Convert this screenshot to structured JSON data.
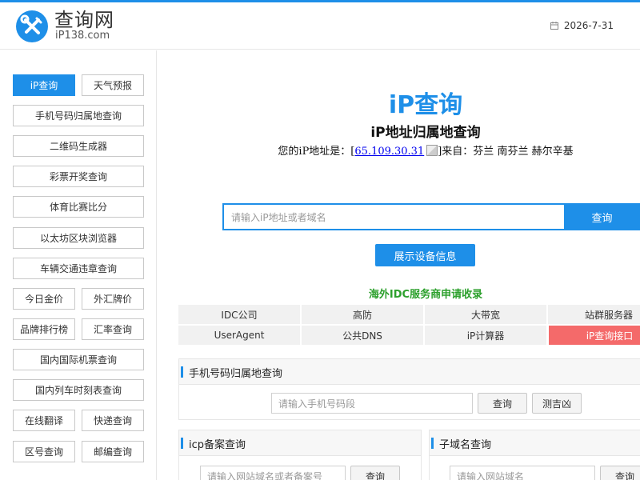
{
  "header": {
    "logo_name": "查询网",
    "logo_sub": "iP138.com",
    "date": "2026-7-31"
  },
  "sidebar": {
    "items": [
      {
        "label": "iP查询",
        "active": true
      },
      {
        "label": "天气预报"
      },
      {
        "label": "手机号码归属地查询"
      },
      {
        "label": "二维码生成器"
      },
      {
        "label": "彩票开奖查询"
      },
      {
        "label": "体育比赛比分"
      },
      {
        "label": "以太坊区块浏览器"
      },
      {
        "label": "车辆交通违章查询"
      },
      {
        "label": "今日金价"
      },
      {
        "label": "外汇牌价"
      },
      {
        "label": "品牌排行榜"
      },
      {
        "label": "汇率查询"
      },
      {
        "label": "国内国际机票查询"
      },
      {
        "label": "国内列车时刻表查询"
      },
      {
        "label": "在线翻译"
      },
      {
        "label": "快递查询"
      },
      {
        "label": "区号查询"
      },
      {
        "label": "邮编查询"
      }
    ]
  },
  "main": {
    "brand": "iP查询",
    "subtitle": "iP地址归属地查询",
    "ip_prefix": "您的iP地址是：[",
    "ip_value": "65.109.30.31",
    "ip_suffix": "]来自：芬兰 南芬兰 赫尔辛基",
    "search_placeholder": "请输入iP地址或者域名",
    "search_button": "查询",
    "device_button": "展示设备信息",
    "idc_title": "海外IDC服务商申请收录",
    "idc_links": [
      {
        "label": "IDC公司"
      },
      {
        "label": "高防"
      },
      {
        "label": "大带宽"
      },
      {
        "label": "站群服务器"
      },
      {
        "label": "UserAgent"
      },
      {
        "label": "公共DNS"
      },
      {
        "label": "iP计算器"
      },
      {
        "label": "iP查询接口"
      }
    ]
  },
  "panels": {
    "phone": {
      "title": "手机号码归属地查询",
      "placeholder": "请输入手机号码段",
      "query_button": "查询",
      "luck_button": "测吉凶"
    },
    "icp": {
      "title": "icp备案查询",
      "placeholder": "请输入网站域名或者备案号",
      "query_button": "查询"
    },
    "subdomain": {
      "title": "子域名查询",
      "placeholder": "请输入网站域名",
      "query_button": "查询"
    }
  },
  "colors": {
    "accent": "#1e8fe8",
    "idc_green": "#2ca02c",
    "api_red": "#f46a6a"
  },
  "icons": {
    "logo": "wrench-screwdriver-icon",
    "date": "calendar-icon"
  }
}
